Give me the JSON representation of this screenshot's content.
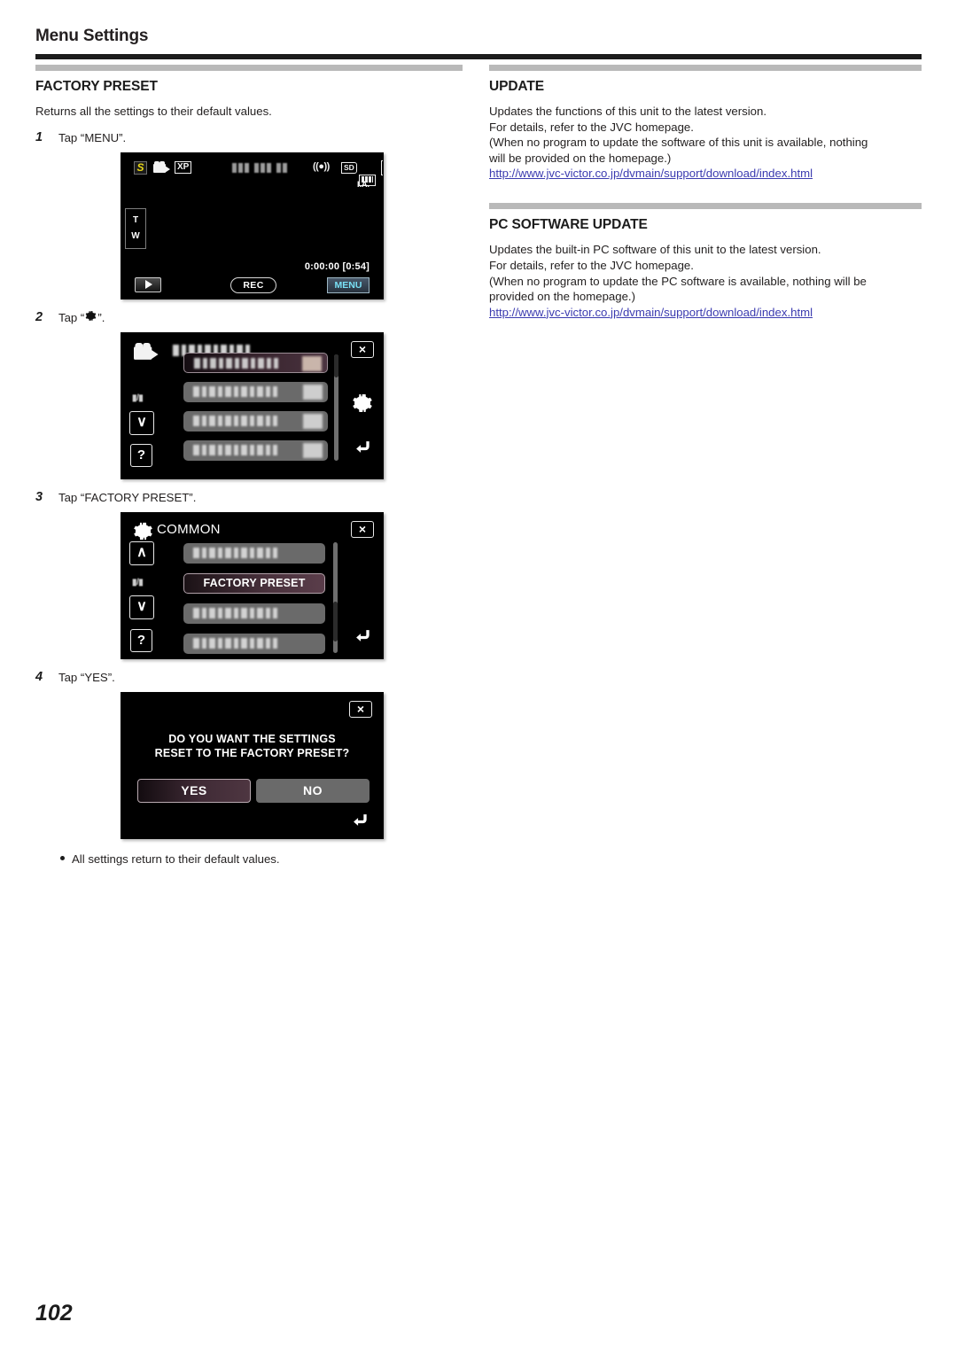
{
  "header": {
    "title": "Menu Settings"
  },
  "left_column": {
    "section_title": "FACTORY PRESET",
    "intro": "Returns all the settings to their default values.",
    "steps": [
      {
        "num": "1",
        "prefix": "Tap “MENU”.",
        "suffix": ""
      },
      {
        "num": "2",
        "prefix": "Tap “",
        "suffix": "”.",
        "icon": "gear-icon"
      },
      {
        "num": "3",
        "prefix": "Tap “FACTORY PRESET”.",
        "suffix": ""
      },
      {
        "num": "4",
        "prefix": "Tap “YES”.",
        "suffix": ""
      }
    ],
    "note": "All settings return to their default values."
  },
  "right_column": {
    "sections": [
      {
        "title": "UPDATE",
        "lines": [
          "Updates the functions of this unit to the latest version.",
          "For details, refer to the JVC homepage.",
          "(When no program to update the software of this unit is available, nothing",
          "will be provided on the homepage.)"
        ],
        "link": "http://www.jvc-victor.co.jp/dvmain/support/download/index.html"
      },
      {
        "title": "PC SOFTWARE UPDATE",
        "lines": [
          "Updates the built-in PC software of this unit to the latest version.",
          "For details, refer to the JVC homepage.",
          "(When no program to update the PC software is available, nothing will be",
          "provided on the homepage.)"
        ],
        "link": "http://www.jvc-victor.co.jp/dvmain/support/download/index.html"
      }
    ]
  },
  "screens": {
    "record_screen": {
      "icons": {
        "scene_s": "S",
        "video_mode": "video-camera-icon",
        "quality": "XP",
        "stabilizer": "image-stabilizer-icon",
        "card": "SD",
        "battery": "battery-icon",
        "drop_detection": "D",
        "intelligent_auto": "I.A."
      },
      "zoom": {
        "tele": "T",
        "wide": "W"
      },
      "counter": "0:00:00",
      "remaining": "[0:54]",
      "buttons": {
        "playback": "playback-icon",
        "record": "REC",
        "menu": "MENU"
      }
    },
    "menu_screen": {
      "close": "×",
      "down": "∨",
      "help": "?",
      "gear": "gear-icon",
      "back": "back-arrow-icon",
      "play_pause": "▮/▮"
    },
    "common_screen": {
      "title": "COMMON",
      "close": "×",
      "up": "∧",
      "down": "∨",
      "help": "?",
      "back": "back-arrow-icon",
      "play_pause": "▮/▮",
      "selected_item": "FACTORY PRESET"
    },
    "confirm_screen": {
      "close": "×",
      "message_line1": "DO YOU WANT THE SETTINGS",
      "message_line2": "RESET TO THE FACTORY PRESET?",
      "yes": "YES",
      "no": "NO",
      "back": "back-arrow-icon"
    }
  },
  "footer": {
    "page_number": "102"
  },
  "colors": {
    "rule": "#1c1c1c",
    "section_bar": "#b9b9b9",
    "link": "#3b3bb0",
    "menu_accent": "#79e0f5",
    "scene_badge": "#e8d617"
  }
}
